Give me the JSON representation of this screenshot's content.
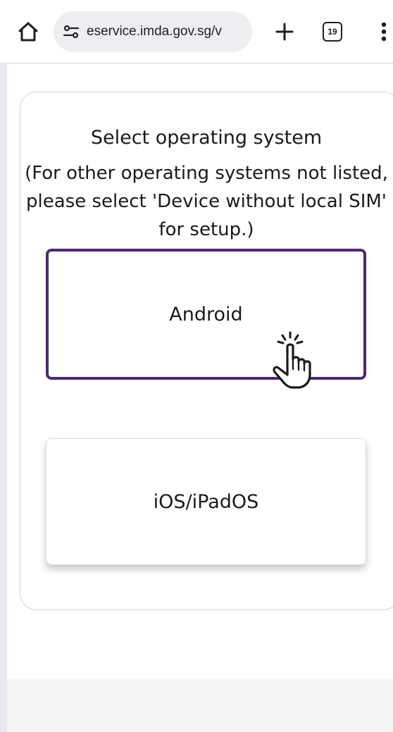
{
  "browser": {
    "url": "eservice.imda.gov.sg/v",
    "tab_count": "19",
    "icons": {
      "home": "home-icon",
      "site_settings": "site-settings-icon",
      "new_tab": "plus-icon",
      "tabs": "tab-switcher-icon",
      "menu": "more-vert-icon"
    }
  },
  "page": {
    "title": "Select operating system",
    "subtitle": "(For other operating systems not listed, please select 'Device without local SIM' for setup.)",
    "options": [
      {
        "label": "Android",
        "selected": true
      },
      {
        "label": "iOS/iPadOS",
        "selected": false
      }
    ]
  },
  "colors": {
    "accent": "#4b2a6e",
    "frame_background": "#ece7f3",
    "text": "#1a1a1a"
  }
}
